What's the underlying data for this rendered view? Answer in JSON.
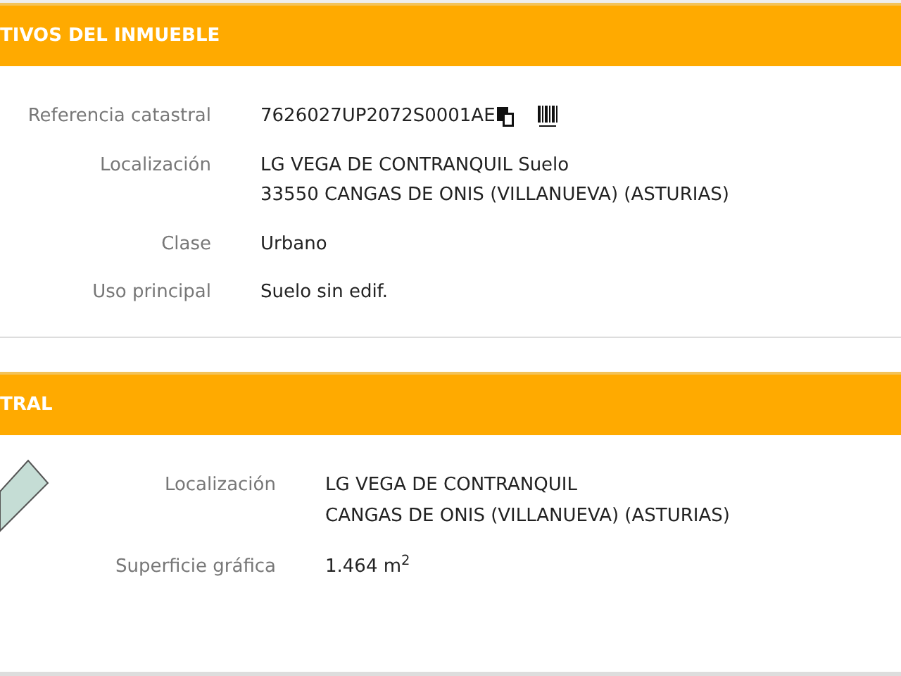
{
  "sections": [
    {
      "title": "TIVOS DEL INMUEBLE",
      "rows": [
        {
          "label": "Referencia catastral",
          "lines": [
            "7626027UP2072S0001AE"
          ],
          "kind": "reference"
        },
        {
          "label": "Localización",
          "lines": [
            "LG VEGA DE CONTRANQUIL Suelo",
            "33550 CANGAS DE ONIS (VILLANUEVA) (ASTURIAS)"
          ],
          "kind": "text"
        },
        {
          "label": "Clase",
          "lines": [
            "Urbano"
          ],
          "kind": "text"
        },
        {
          "label": "Uso principal",
          "lines": [
            "Suelo sin edif."
          ],
          "kind": "text"
        }
      ]
    },
    {
      "title": "TRAL",
      "rows": [
        {
          "label": "Localización",
          "lines": [
            "LG VEGA DE CONTRANQUIL",
            "CANGAS DE ONIS (VILLANUEVA) (ASTURIAS)"
          ],
          "kind": "text"
        },
        {
          "label": "Superficie gráfica",
          "lines": [
            "1.464 m$^{2}$"
          ],
          "kind": "text"
        }
      ]
    }
  ]
}
